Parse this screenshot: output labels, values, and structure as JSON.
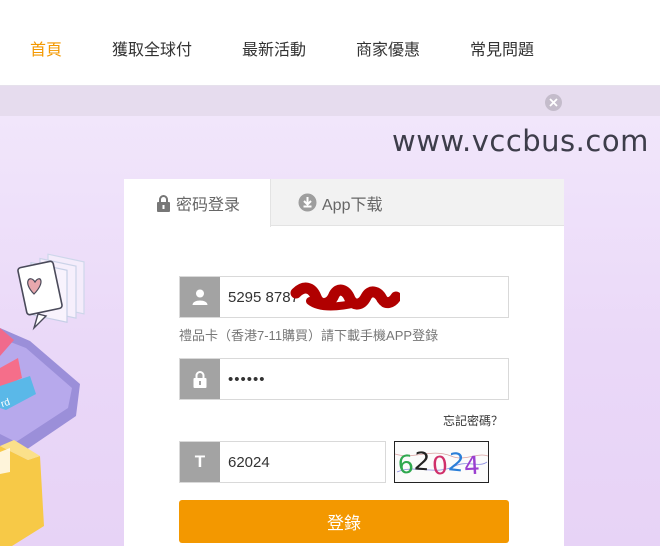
{
  "nav": {
    "items": [
      {
        "label": "首頁",
        "active": true
      },
      {
        "label": "獲取全球付",
        "active": false
      },
      {
        "label": "最新活動",
        "active": false
      },
      {
        "label": "商家優惠",
        "active": false
      },
      {
        "label": "常見問題",
        "active": false
      }
    ]
  },
  "watermark": "www.vccbus.com",
  "login": {
    "tabs": [
      {
        "label": "密码登录",
        "icon": "lock-icon",
        "active": true
      },
      {
        "label": "App下载",
        "icon": "download-icon",
        "active": false
      }
    ],
    "card_number": {
      "value": "5295 8787",
      "icon": "user-icon"
    },
    "hint": "禮品卡（香港7-11購買）請下載手機APP登錄",
    "password": {
      "value": "••••••",
      "icon": "lock-icon"
    },
    "forgot_label": "忘記密碼？",
    "captcha": {
      "value": "62024",
      "icon_letter": "T",
      "image_text": "62024"
    },
    "submit_label": "登錄"
  },
  "colors": {
    "accent": "#f39800",
    "redaction": "#b00000",
    "hero_bg": "#ecdcf8"
  }
}
